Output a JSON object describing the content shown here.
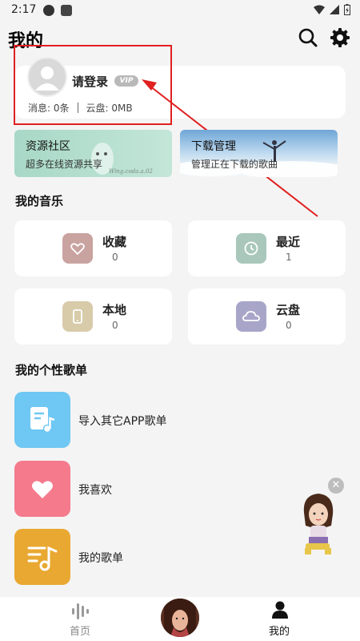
{
  "status_bar": {
    "time": "2:17"
  },
  "header": {
    "title": "我的"
  },
  "profile": {
    "login_label": "请登录",
    "vip_label": "VIP",
    "messages": "消息: 0条",
    "cloud": "云盘: 0MB"
  },
  "banners": [
    {
      "title": "资源社区",
      "subtitle": "超多在线资源共享",
      "handwriting": "Wing.coda.a.02"
    },
    {
      "title": "下载管理",
      "subtitle": "管理正在下载的歌曲"
    }
  ],
  "music_section": {
    "title": "我的音乐",
    "items": [
      {
        "label": "收藏",
        "count": "0",
        "icon": "heart-icon",
        "color": "#c9a3a0"
      },
      {
        "label": "最近",
        "count": "1",
        "icon": "clock-icon",
        "color": "#a9c7bb"
      },
      {
        "label": "本地",
        "count": "0",
        "icon": "phone-icon",
        "color": "#d8cbaa"
      },
      {
        "label": "云盘",
        "count": "0",
        "icon": "cloud-icon",
        "color": "#a7a6c9"
      }
    ]
  },
  "playlist_section": {
    "title": "我的个性歌单",
    "items": [
      {
        "label": "导入其它APP歌单",
        "icon": "music-doc-icon",
        "color": "#6fc7f3"
      },
      {
        "label": "我喜欢",
        "icon": "heart-icon",
        "color": "#f47a8c"
      },
      {
        "label": "我的歌单",
        "icon": "playlist-icon",
        "color": "#e9a832"
      }
    ]
  },
  "bottom_nav": {
    "home": "首页",
    "mine": "我的"
  },
  "colors": {
    "annotation": "#e02020",
    "background": "#f4f4f4"
  }
}
